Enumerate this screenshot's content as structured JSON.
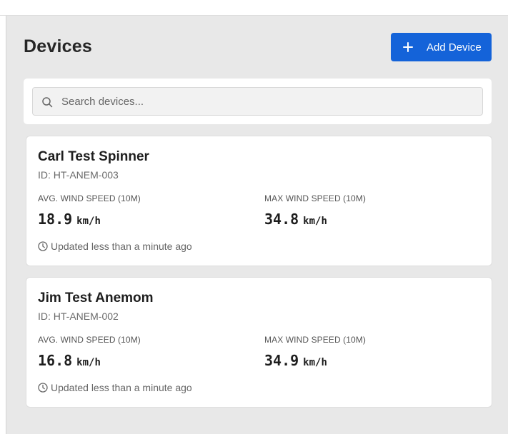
{
  "page": {
    "title": "Devices"
  },
  "toolbar": {
    "add_label": "Add Device"
  },
  "search": {
    "placeholder": "Search devices..."
  },
  "devices": [
    {
      "name": "Carl Test Spinner",
      "id_label": "ID: HT-ANEM-003",
      "avg_label": "AVG. WIND SPEED (10M)",
      "avg_value": "18.9",
      "avg_unit": "km/h",
      "max_label": "MAX WIND SPEED (10M)",
      "max_value": "34.8",
      "max_unit": "km/h",
      "updated": "Updated less than a minute ago"
    },
    {
      "name": "Jim Test Anemom",
      "id_label": "ID: HT-ANEM-002",
      "avg_label": "AVG. WIND SPEED (10M)",
      "avg_value": "16.8",
      "avg_unit": "km/h",
      "max_label": "MAX WIND SPEED (10M)",
      "max_value": "34.9",
      "max_unit": "km/h",
      "updated": "Updated less than a minute ago"
    }
  ],
  "colors": {
    "accent": "#1463d9",
    "background": "#e8e8e8",
    "card": "#ffffff"
  },
  "icons": {
    "add": "plus-icon",
    "search": "search-icon",
    "updated": "clock-icon"
  }
}
